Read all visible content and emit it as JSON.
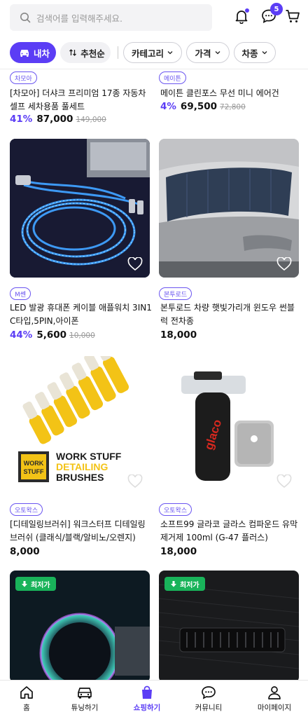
{
  "header": {
    "search_placeholder": "검색어를 입력해주세요.",
    "chat_badge": "5"
  },
  "filters": {
    "car": "내차",
    "sort": "추천순",
    "category": "카테고리",
    "price": "가격",
    "model": "차종"
  },
  "products": [
    {
      "badge": "차모아",
      "title1": "[차모아] 더샤크 프리미엄 17종 자동차",
      "title2": "셀프 세차용품 풀세트",
      "discount": "41%",
      "price": "87,000",
      "old_price": "149,000"
    },
    {
      "badge": "메이튼",
      "title1": "메이튼 클린포스 무선 미니 에어건",
      "title2": "",
      "discount": "4%",
      "price": "69,500",
      "old_price": "72,800"
    },
    {
      "badge": "M쎈",
      "title1": "LED 발광 휴대폰 케이블 애플워치 3IN1",
      "title2": "C타입,5PIN,아이폰",
      "discount": "44%",
      "price": "5,600",
      "old_price": "10,000"
    },
    {
      "badge": "본투로드",
      "title1": "본투로드 차량 햇빛가리개 윈도우 썬블",
      "title2": "럭 전차종",
      "discount": "",
      "price": "18,000",
      "old_price": ""
    },
    {
      "badge": "오토왁스",
      "title1": "[디테일링브러쉬] 워크스터프 디테일링",
      "title2": "브러쉬 (클래식/블랙/알비노/오렌지)",
      "discount": "",
      "price": "8,000",
      "old_price": ""
    },
    {
      "badge": "오토왁스",
      "title1": "소프트99 글라코 글라스 컴파운드 유막",
      "title2": "제거제 100ml (G-47 플러스)",
      "discount": "",
      "price": "18,000",
      "old_price": ""
    }
  ],
  "images": {
    "brush_line1": "WORK STUFF",
    "brush_line2": "DETAILING",
    "brush_line3": "BRUSHES",
    "brush_logo1": "WORK",
    "brush_logo2": "STUFF",
    "glaco": "glaco"
  },
  "low_price_tag": "최저가",
  "nav": {
    "home": "홈",
    "tuning": "튜닝하기",
    "shopping": "쇼핑하기",
    "community": "커뮤니티",
    "mypage": "마이페이지"
  },
  "colors": {
    "accent": "#5b3df5",
    "low_price": "#19b35a"
  }
}
